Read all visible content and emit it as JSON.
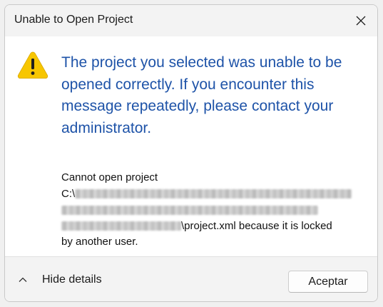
{
  "window": {
    "title": "Unable to Open Project"
  },
  "dialog": {
    "icon": "warning-icon",
    "main_instruction": "The project you selected was unable to be opened correctly. If you encounter this message repeatedly, please contact your administrator.",
    "details": {
      "line1": "Cannot open project",
      "path_prefix": "C:\\",
      "path_suffix": "\\project.xml because it is locked",
      "line_end": "by another user."
    }
  },
  "footer": {
    "toggle_label": "Hide details",
    "ok_label": "Aceptar"
  },
  "colors": {
    "instruction": "#1e53a8",
    "warning_fill": "#f7c600",
    "titlebar_bg": "#f3f3f3",
    "content_bg": "#ffffff"
  }
}
